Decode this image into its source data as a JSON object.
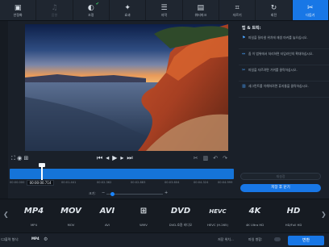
{
  "toolbar": {
    "items": [
      {
        "label": "안정화",
        "icon": "stabilize-icon",
        "glyph": "▣"
      },
      {
        "label": "음향",
        "icon": "audio-icon",
        "glyph": "♫"
      },
      {
        "label": "조정",
        "icon": "adjust-icon",
        "glyph": "◐"
      },
      {
        "label": "효과",
        "icon": "effects-icon",
        "glyph": "✦"
      },
      {
        "label": "자막",
        "icon": "subtitles-icon",
        "glyph": "☰"
      },
      {
        "label": "워터마크",
        "icon": "watermark-icon",
        "glyph": "▤"
      },
      {
        "label": "자르기",
        "icon": "crop-icon",
        "glyph": "⌗"
      },
      {
        "label": "회전",
        "icon": "rotate-icon",
        "glyph": "↻"
      },
      {
        "label": "다듬기",
        "icon": "trim-icon",
        "glyph": "✂"
      }
    ],
    "active_index": 8,
    "check_index": 2,
    "disabled_index": 1
  },
  "tips": {
    "title": "팁 & 트릭:",
    "items": [
      "파일을 잘라낼 위치에 재생 마커를 놓으십시오.",
      "줌 이 범위에서 처리하면 타임라인의 확대하십시오.",
      "파일을 자르려면 가위를 클릭하십시오.",
      "세그먼트를 이해하려면 휴지통을 클릭하십시오."
    ],
    "disabled_button": "재설정",
    "save_button": "저장 후 닫기"
  },
  "timeline": {
    "current_time": "00:00:00.714",
    "ticks": [
      "00:00.000",
      "00:01.441",
      "00:02.362",
      "00:02.883",
      "00:03.604",
      "00:04.324",
      "00:04.999"
    ],
    "scale_label": "크기:"
  },
  "formats": [
    {
      "logo": "MP4",
      "caption": "MP4"
    },
    {
      "logo": "MOV",
      "caption": "MOV"
    },
    {
      "logo": "AVI",
      "caption": "AVI"
    },
    {
      "logo": "⊞",
      "caption": "WMV"
    },
    {
      "logo": "DVD",
      "caption": "DVD-호환 비디오"
    },
    {
      "logo": "HEVC",
      "caption": "HEVC (H.265)"
    },
    {
      "logo": "4K",
      "caption": "4K Ultra HD"
    },
    {
      "logo": "HD",
      "caption": "HD/Full HD"
    }
  ],
  "bottom": {
    "output_label": "출력 형식:",
    "output_value": "MP4",
    "save_to": "저장 위치...",
    "merge": "파일 병합:",
    "convert": "변환"
  }
}
